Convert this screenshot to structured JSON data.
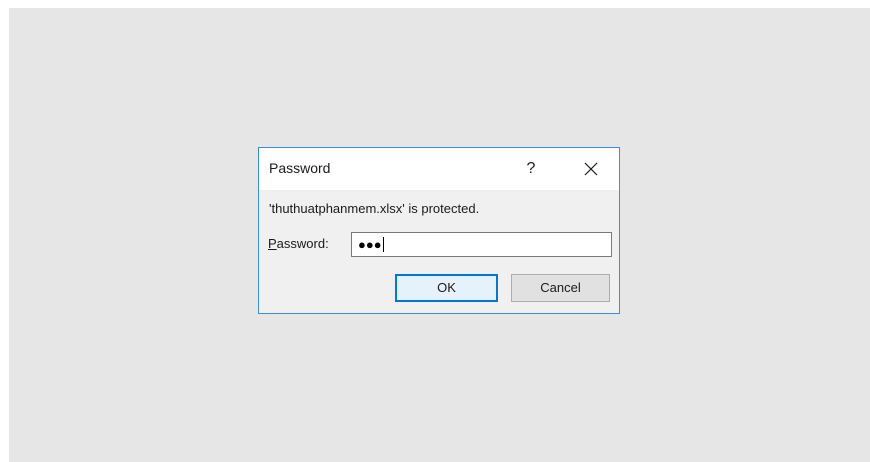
{
  "dialog": {
    "title": "Password",
    "help_label": "?",
    "close_icon": "close-icon",
    "message": "'thuthuatphanmem.xlsx' is protected.",
    "password_label_accesskey": "P",
    "password_label_rest": "assword:",
    "password_mask": "●●●",
    "ok_label": "OK",
    "cancel_label": "Cancel"
  },
  "colors": {
    "backdrop": "#e6e6e6",
    "dialog_border": "#3c8ddd",
    "focus_button_border": "#0078d7"
  }
}
